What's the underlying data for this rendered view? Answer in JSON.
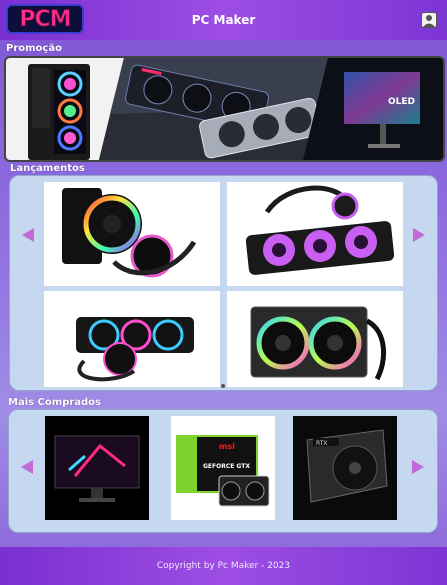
{
  "header": {
    "logo_text": "PCM",
    "title": "PC Maker",
    "user_icon": "user-icon"
  },
  "sections": {
    "promo": "Promoção",
    "launches": "Lançamentos",
    "top": "Mais Comprados"
  },
  "promo": {
    "images": [
      "pc-case-rgb",
      "graphics-cards",
      "oled-monitor"
    ],
    "monitor_text": "OLED"
  },
  "launches": {
    "products": [
      "rgb-water-cooler-single-fan",
      "rgb-water-cooler-triple-fan-purple",
      "rgb-water-cooler-triple-fan-black",
      "rgb-water-cooler-dual-fan"
    ],
    "prev_icon": "chevron-left-icon",
    "next_icon": "chevron-right-icon"
  },
  "top": {
    "products": [
      "gaming-monitor",
      "msi-geforce-gtx-box",
      "nvidia-rtx-card"
    ],
    "box_brand": "msi",
    "box_model": "GEFORCE GTX"
  },
  "footer": {
    "text": "Copyright by Pc Maker - 2023"
  },
  "colors": {
    "header": "#8b3fdb",
    "panel": "#c6d8ef",
    "arrow": "#c36ad8"
  }
}
